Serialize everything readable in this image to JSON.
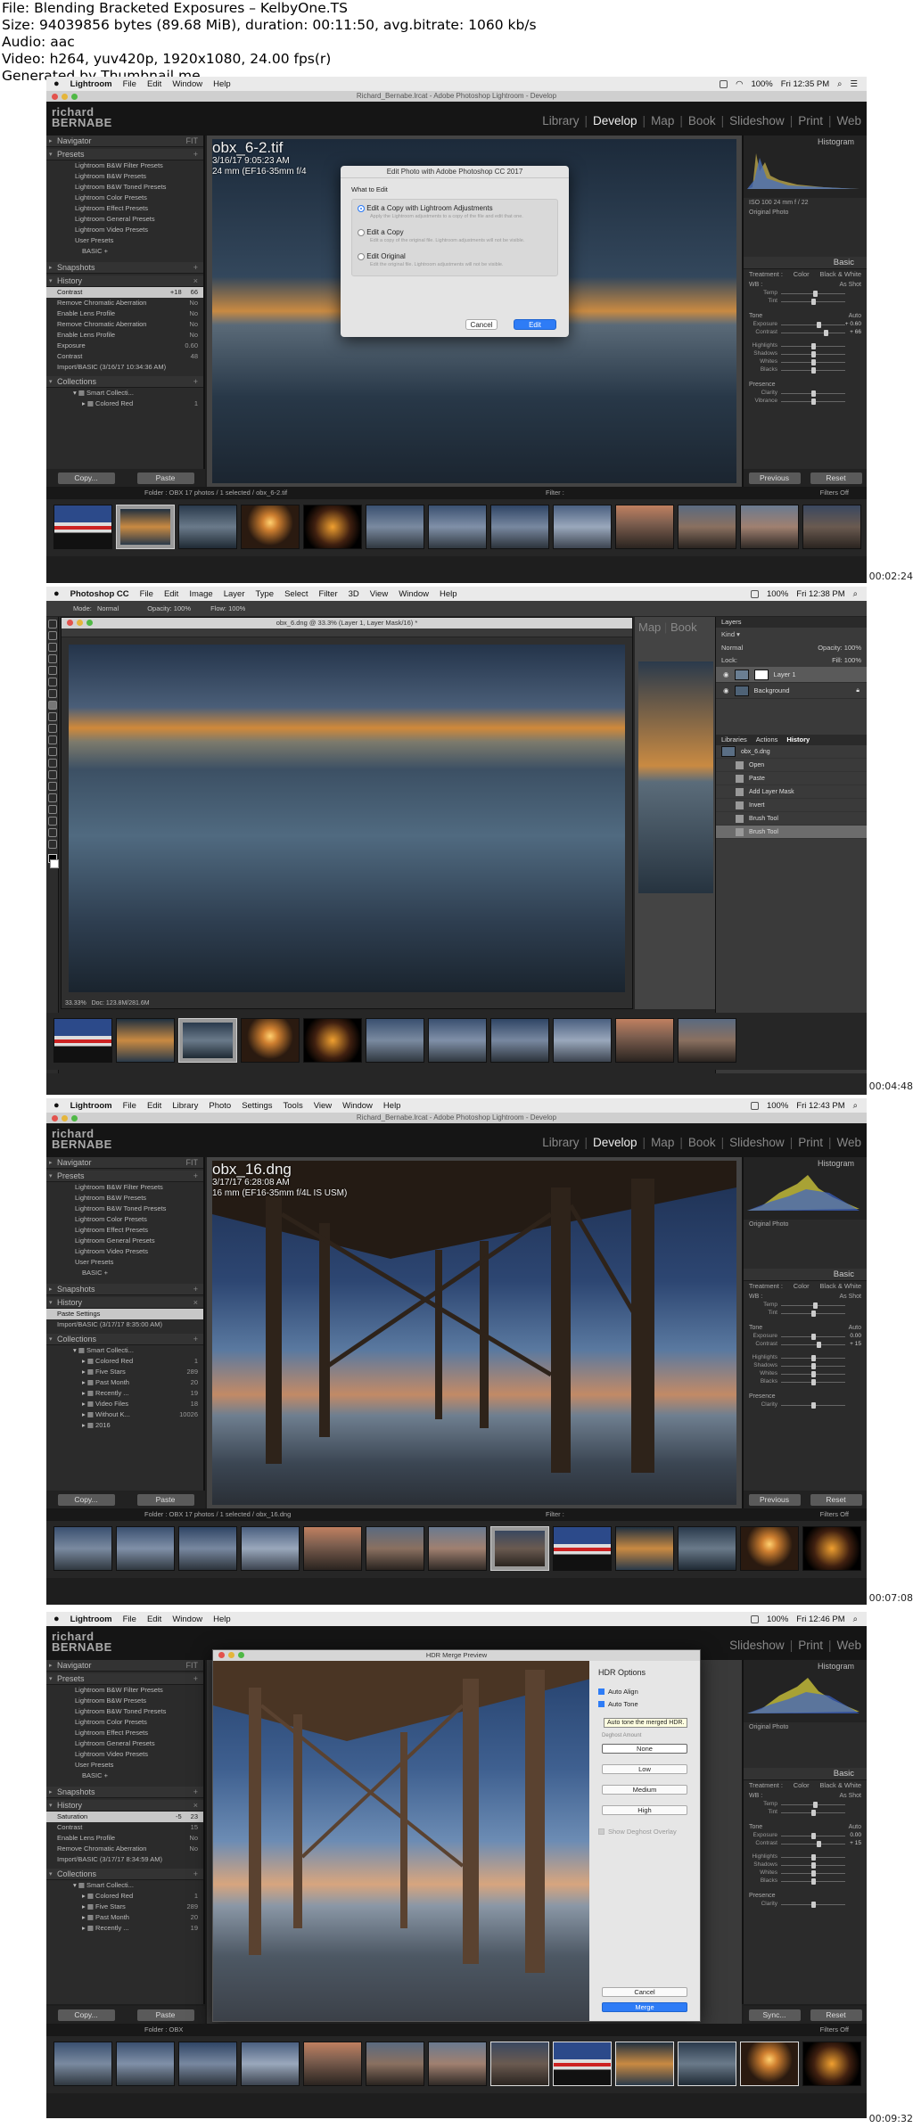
{
  "file_info": {
    "line1": "File: Blending Bracketed Exposures – KelbyOne.TS",
    "line2": "Size: 94039856 bytes (89.68 MiB), duration: 00:11:50, avg.bitrate: 1060 kb/s",
    "line3": "Audio: aac",
    "line4": "Video: h264, yuv420p, 1920x1080, 24.00 fps(r)",
    "line5": "Generated by Thumbnail me"
  },
  "lr_modules": [
    "Library",
    "Develop",
    "Map",
    "Book",
    "Slideshow",
    "Print",
    "Web"
  ],
  "lr_logo": {
    "line1": "richard",
    "line2": "BERNABE"
  },
  "menubar": {
    "lr_items": [
      "Lightroom",
      "File",
      "Edit",
      "Window",
      "Help"
    ],
    "lr_items_full": [
      "Lightroom",
      "File",
      "Edit",
      "Library",
      "Photo",
      "Settings",
      "Tools",
      "View",
      "Window",
      "Help"
    ],
    "ps_items": [
      "Photoshop CC",
      "File",
      "Edit",
      "Image",
      "Layer",
      "Type",
      "Select",
      "Filter",
      "3D",
      "View",
      "Window",
      "Help"
    ],
    "battery": "100%"
  },
  "frames": [
    {
      "timestamp": "00:02:24",
      "clock": "Fri 12:35 PM",
      "window_title": "Richard_Bernabe.lrcat - Adobe Photoshop Lightroom - Develop",
      "photo": {
        "name": "obx_6-2.tif",
        "date": "3/16/17 9:05:23 AM",
        "lens": "24 mm (EF16-35mm f/4"
      },
      "history": [
        {
          "label": "Contrast",
          "a": "+18",
          "b": "66"
        },
        {
          "label": "Remove Chromatic Aberration",
          "a": "",
          "b": "No"
        },
        {
          "label": "Enable Lens Profile",
          "a": "",
          "b": "No"
        },
        {
          "label": "Remove Chromatic Aberration",
          "a": "",
          "b": "No"
        },
        {
          "label": "Enable Lens Profile",
          "a": "",
          "b": "No"
        },
        {
          "label": "Exposure",
          "a": "",
          "b": "0.60"
        },
        {
          "label": "Contrast",
          "a": "",
          "b": "48"
        },
        {
          "label": "Import/BASIC (3/16/17 10:34:36 AM)",
          "a": "",
          "b": ""
        }
      ],
      "collections": [
        {
          "label": "Smart Collecti...",
          "count": ""
        },
        {
          "label": "Colored Red",
          "count": "1"
        }
      ],
      "toolbar": "Folder : OBX     17 photos / 1 selected / obx_6-2.tif",
      "filter": "Filter :",
      "filters_off": "Filters Off",
      "dialog": {
        "title": "Edit Photo with Adobe Photoshop CC 2017",
        "what": "What to Edit",
        "options": [
          {
            "label": "Edit a Copy with Lightroom Adjustments",
            "desc": "Apply the Lightroom adjustments to a copy of the file and edit that one."
          },
          {
            "label": "Edit a Copy",
            "desc": "Edit a copy of the original file. Lightroom adjustments will not be visible."
          },
          {
            "label": "Edit Original",
            "desc": "Edit the original file. Lightroom adjustments will not be visible."
          }
        ],
        "cancel": "Cancel",
        "ok": "Edit"
      },
      "right": {
        "temp": "As Shot",
        "exposure": "+ 0.60",
        "contrast": "+ 66",
        "previous": "Previous",
        "reset": "Reset"
      }
    },
    {
      "timestamp": "00:04:48",
      "clock": "Fri 12:38 PM",
      "doc_title": "obx_6.dng @ 33.3% (Layer 1, Layer Mask/16) *",
      "zoom": "33.33%",
      "doc_info": "Doc: 123.8M/281.6M",
      "options_bar": {
        "mode_label": "Mode:",
        "mode": "Normal",
        "opacity": "Opacity: 100%",
        "flow": "Flow: 100%"
      },
      "layers_tab": "Layers",
      "blend": "Normal",
      "layers_opacity": "Opacity: 100%",
      "fill": "Fill: 100%",
      "lock": "Lock:",
      "layers": [
        {
          "name": "Layer 1",
          "sel": true
        },
        {
          "name": "Background",
          "sel": false
        }
      ],
      "tabs2": [
        "Libraries",
        "Actions",
        "History"
      ],
      "history_file": "obx_6.dng",
      "history": [
        {
          "label": "Open",
          "sel": false
        },
        {
          "label": "Paste",
          "sel": false
        },
        {
          "label": "Add Layer Mask",
          "sel": false
        },
        {
          "label": "Invert",
          "sel": false
        },
        {
          "label": "Brush Tool",
          "sel": false
        },
        {
          "label": "Brush Tool",
          "sel": true
        }
      ]
    },
    {
      "timestamp": "00:07:08",
      "clock": "Fri 12:43 PM",
      "window_title": "Richard_Bernabe.lrcat - Adobe Photoshop Lightroom - Develop",
      "photo": {
        "name": "obx_16.dng",
        "date": "3/17/17 6:28:08 AM",
        "lens": "16 mm (EF16-35mm f/4L IS USM)"
      },
      "history": [
        {
          "label": "Paste Settings",
          "a": "",
          "b": ""
        },
        {
          "label": "Import/BASIC (3/17/17 8:35:00 AM)",
          "a": "",
          "b": ""
        }
      ],
      "collections": [
        {
          "label": "Smart Collecti...",
          "count": ""
        },
        {
          "label": "Colored Red",
          "count": "1"
        },
        {
          "label": "Five Stars",
          "count": "289"
        },
        {
          "label": "Past Month",
          "count": "20"
        },
        {
          "label": "Recently ...",
          "count": "19"
        },
        {
          "label": "Video Files",
          "count": "18"
        },
        {
          "label": "Without K...",
          "count": "10026"
        },
        {
          "label": "2016",
          "count": ""
        }
      ],
      "toolbar": "Folder : OBX     17 photos / 1 selected / obx_16.dng",
      "filter": "Filter :",
      "filters_off": "Filters Off",
      "right": {
        "temp": "As Shot",
        "exposure": "0.00",
        "contrast": "+ 15",
        "previous": "Previous",
        "reset": "Reset"
      }
    },
    {
      "timestamp": "00:09:32",
      "clock": "Fri 12:46 PM",
      "history": [
        {
          "label": "Saturation",
          "a": "-5",
          "b": "23"
        },
        {
          "label": "Contrast",
          "a": "",
          "b": "15"
        },
        {
          "label": "Enable Lens Profile",
          "a": "",
          "b": "No"
        },
        {
          "label": "Remove Chromatic Aberration",
          "a": "",
          "b": "No"
        },
        {
          "label": "Import/BASIC (3/17/17 8:34:59 AM)",
          "a": "",
          "b": ""
        }
      ],
      "collections": [
        {
          "label": "Smart Collecti...",
          "count": ""
        },
        {
          "label": "Colored Red",
          "count": "1"
        },
        {
          "label": "Five Stars",
          "count": "289"
        },
        {
          "label": "Past Month",
          "count": "20"
        },
        {
          "label": "Recently ...",
          "count": "19"
        }
      ],
      "toolbar": "Folder : OBX",
      "filters_off": "Filters Off",
      "hdr": {
        "title": "HDR Merge Preview",
        "options_title": "HDR Options",
        "auto_align": "Auto Align",
        "auto_tone": "Auto Tone",
        "tooltip": "Auto tone the merged HDR.",
        "deghost_label": "Deghost Amount",
        "deghost": [
          "None",
          "Low",
          "Medium",
          "High"
        ],
        "overlay": "Show Deghost Overlay",
        "cancel": "Cancel",
        "merge": "Merge"
      },
      "right": {
        "temp": "As Shot",
        "exposure": "0.00",
        "contrast": "+ 15",
        "sync": "Sync...",
        "reset": "Reset"
      }
    }
  ],
  "presets": [
    "Lightroom B&W Filter Presets",
    "Lightroom B&W Presets",
    "Lightroom B&W Toned Presets",
    "Lightroom Color Presets",
    "Lightroom Effect Presets",
    "Lightroom General Presets",
    "Lightroom Video Presets",
    "User Presets",
    "BASIC +"
  ],
  "panels": {
    "navigator": "Navigator",
    "navigator_fit": "FIT",
    "presets": "Presets",
    "snapshots": "Snapshots",
    "history": "History",
    "collections": "Collections",
    "copy": "Copy...",
    "paste": "Paste"
  },
  "right_panel": {
    "histogram": "Histogram",
    "original_photo": "Original Photo",
    "basic": "Basic",
    "treatment": "Treatment :",
    "color": "Color",
    "bw": "Black & White",
    "wb": "WB :",
    "temp_label": "Temp",
    "tint_label": "Tint",
    "tone": "Tone",
    "auto": "Auto",
    "exposure_label": "Exposure",
    "contrast_label": "Contrast",
    "highlights": "Highlights",
    "shadows": "Shadows",
    "whites": "Whites",
    "blacks": "Blacks",
    "presence": "Presence",
    "clarity": "Clarity",
    "vibrance": "Vibrance",
    "hist_info": "ISO 100     24 mm     f / 22"
  },
  "colors": {
    "accent": "#2e7cf6",
    "lr_bg": "#2b2b2b",
    "dark": "#151515"
  }
}
